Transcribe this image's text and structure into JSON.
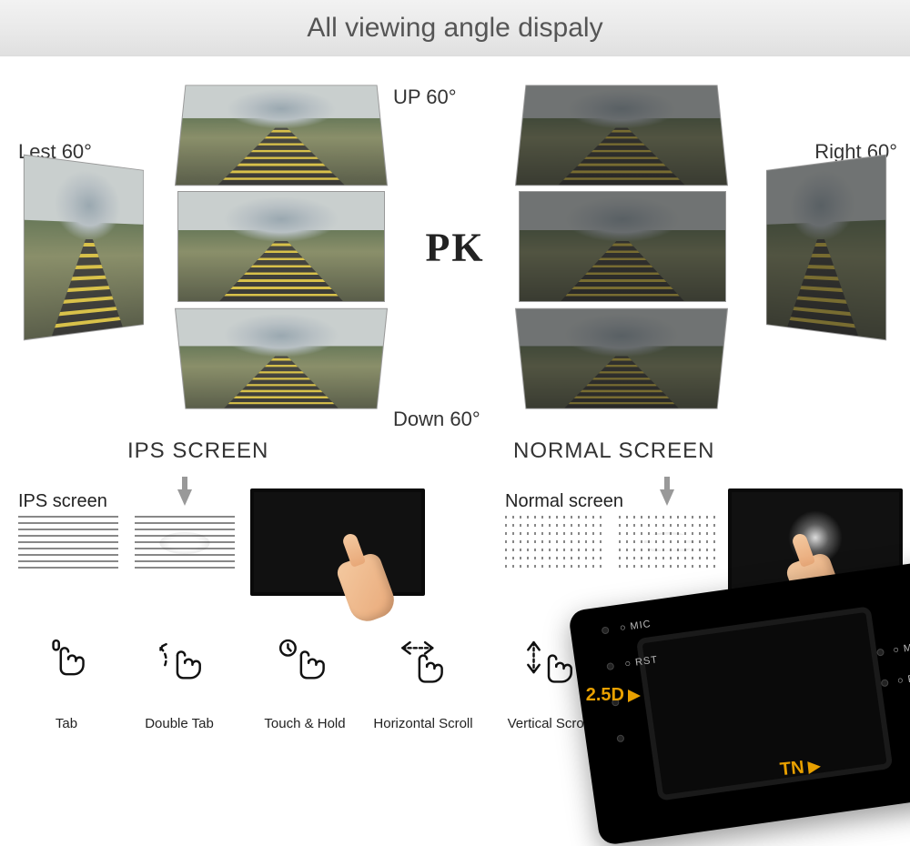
{
  "header": {
    "title": "All viewing angle dispaly"
  },
  "angles": {
    "up": "UP 60°",
    "down": "Down 60°",
    "left": "Lest 60°",
    "right": "Right 60°",
    "pk": "PK"
  },
  "screens": {
    "ips_title": "IPS SCREEN",
    "normal_title": "NORMAL SCREEN",
    "ips_sub": "IPS screen",
    "normal_sub": "Normal screen"
  },
  "gestures": {
    "tab": "Tab",
    "double_tab": "Double Tab",
    "touch_hold": "Touch & Hold",
    "h_scroll": "Horizontal Scroll",
    "v_scroll": "Vertical Scroll"
  },
  "device": {
    "mic": "MIC",
    "rst": "RST",
    "badge_25d": "2.5D",
    "badge_tn": "TN"
  }
}
